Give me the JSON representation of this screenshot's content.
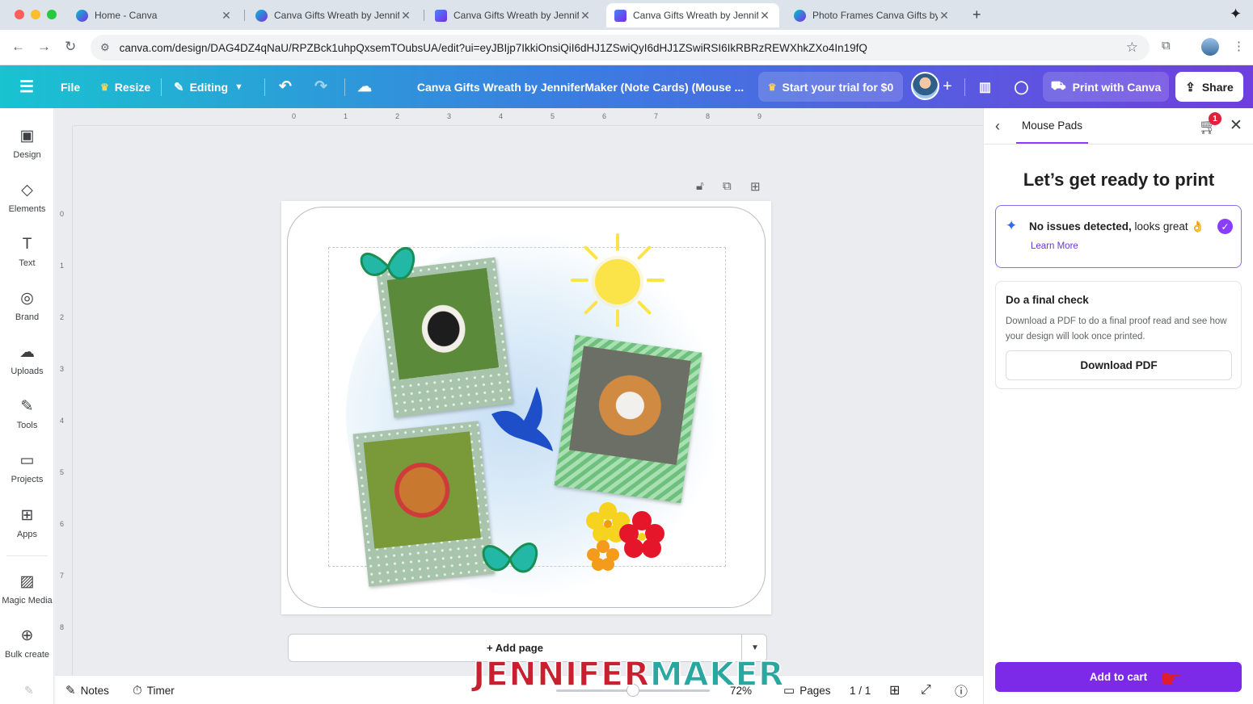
{
  "browser": {
    "tabs": [
      {
        "title": "Home - Canva",
        "active": false,
        "favicon": "canva-icon"
      },
      {
        "title": "Canva Gifts Wreath by JenniferMaker",
        "active": false,
        "favicon": "canva-icon"
      },
      {
        "title": "Canva Gifts Wreath by JenniferMaker",
        "active": false,
        "favicon": "canva-doc-icon"
      },
      {
        "title": "Canva Gifts Wreath by JenniferMaker",
        "active": true,
        "favicon": "canva-doc-icon"
      },
      {
        "title": "Photo Frames Canva Gifts by JenniferMaker",
        "active": false,
        "favicon": "canva-icon"
      }
    ],
    "new_tab": "+",
    "url": "canva.com/design/DAG4DZ4qNaU/RPZBck1uhpQxsemTOubsUA/edit?ui=eyJBIjp7IkkiOnsiQiI6dHJ1ZSwiQyI6dHJ1ZSwiRSI6IkRBRzREWXhkZXo4In19fQ"
  },
  "header": {
    "menu_icon": "hamburger-icon",
    "file": "File",
    "resize": "Resize",
    "editing": "Editing",
    "title": "Canva Gifts Wreath by JenniferMaker (Note Cards) (Mouse ...",
    "trial": "Start your trial for $0",
    "print": "Print with Canva",
    "share": "Share"
  },
  "sidebar": {
    "items": [
      {
        "label": "Design",
        "icon": "design-icon"
      },
      {
        "label": "Elements",
        "icon": "elements-icon"
      },
      {
        "label": "Text",
        "icon": "text-icon"
      },
      {
        "label": "Brand",
        "icon": "brand-icon"
      },
      {
        "label": "Uploads",
        "icon": "uploads-icon"
      },
      {
        "label": "Tools",
        "icon": "tools-icon"
      },
      {
        "label": "Projects",
        "icon": "projects-icon"
      },
      {
        "label": "Apps",
        "icon": "apps-icon"
      },
      {
        "label": "Magic Media",
        "icon": "magic-media-icon"
      },
      {
        "label": "Bulk create",
        "icon": "bulk-create-icon"
      }
    ]
  },
  "ruler": {
    "top": [
      "0",
      "1",
      "2",
      "3",
      "4",
      "5",
      "6",
      "7",
      "8",
      "9"
    ],
    "left": [
      "0",
      "1",
      "2",
      "3",
      "4",
      "5",
      "6",
      "7",
      "8"
    ]
  },
  "canvas": {
    "add_page": "+ Add page"
  },
  "bottom": {
    "notes": "Notes",
    "timer": "Timer",
    "zoom": "72%",
    "pages": "Pages",
    "page_count": "1 / 1"
  },
  "watermark": {
    "part1": "JENNIFER",
    "part2": "MAKER"
  },
  "panel": {
    "tab": "Mouse Pads",
    "cart_count": "1",
    "title": "Let’s get ready to print",
    "issues_bold": "No issues detected,",
    "issues_rest": " looks great 👌",
    "learn_more": "Learn More",
    "final_title": "Do a final check",
    "final_desc": "Download a PDF to do a final proof read and see how your design will look once printed.",
    "download": "Download PDF",
    "add_to_cart": "Add to cart"
  },
  "colors": {
    "accent": "#8b3dff",
    "add_to_cart": "#7d2ae8",
    "header_start": "#19c3d0",
    "header_end": "#6f3fe0",
    "badge": "#e0203a"
  }
}
